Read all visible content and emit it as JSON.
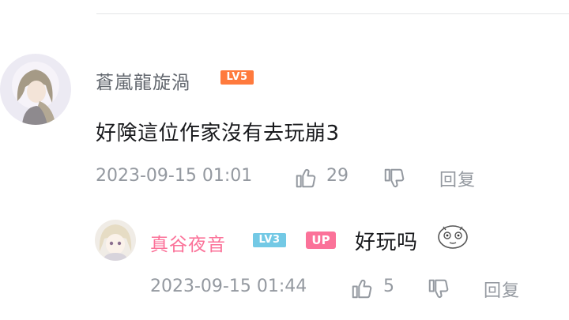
{
  "main_comment": {
    "username": "蒼嵐龍旋渦",
    "level": "LV5",
    "content": "好険這位作家沒有去玩崩3",
    "timestamp": "2023-09-15 01:01",
    "likes": "29",
    "reply_label": "回复",
    "icons": {
      "avatar": "user-avatar-icon",
      "like": "thumbs-up-icon",
      "dislike": "thumbs-down-icon"
    },
    "colors": {
      "username": "#61666d",
      "level_badge": "#ff7a3d"
    }
  },
  "reply_comment": {
    "username": "真谷夜音",
    "level": "LV3",
    "up_badge": "UP",
    "content": "好玩吗",
    "timestamp": "2023-09-15 01:44",
    "likes": "5",
    "reply_label": "回复",
    "icons": {
      "avatar": "user-avatar-icon",
      "emoji": "emoji-face-icon",
      "like": "thumbs-up-icon",
      "dislike": "thumbs-down-icon"
    },
    "colors": {
      "username": "#fb7299",
      "level_badge": "#73c9e5",
      "up_badge": "#fb7299"
    }
  }
}
